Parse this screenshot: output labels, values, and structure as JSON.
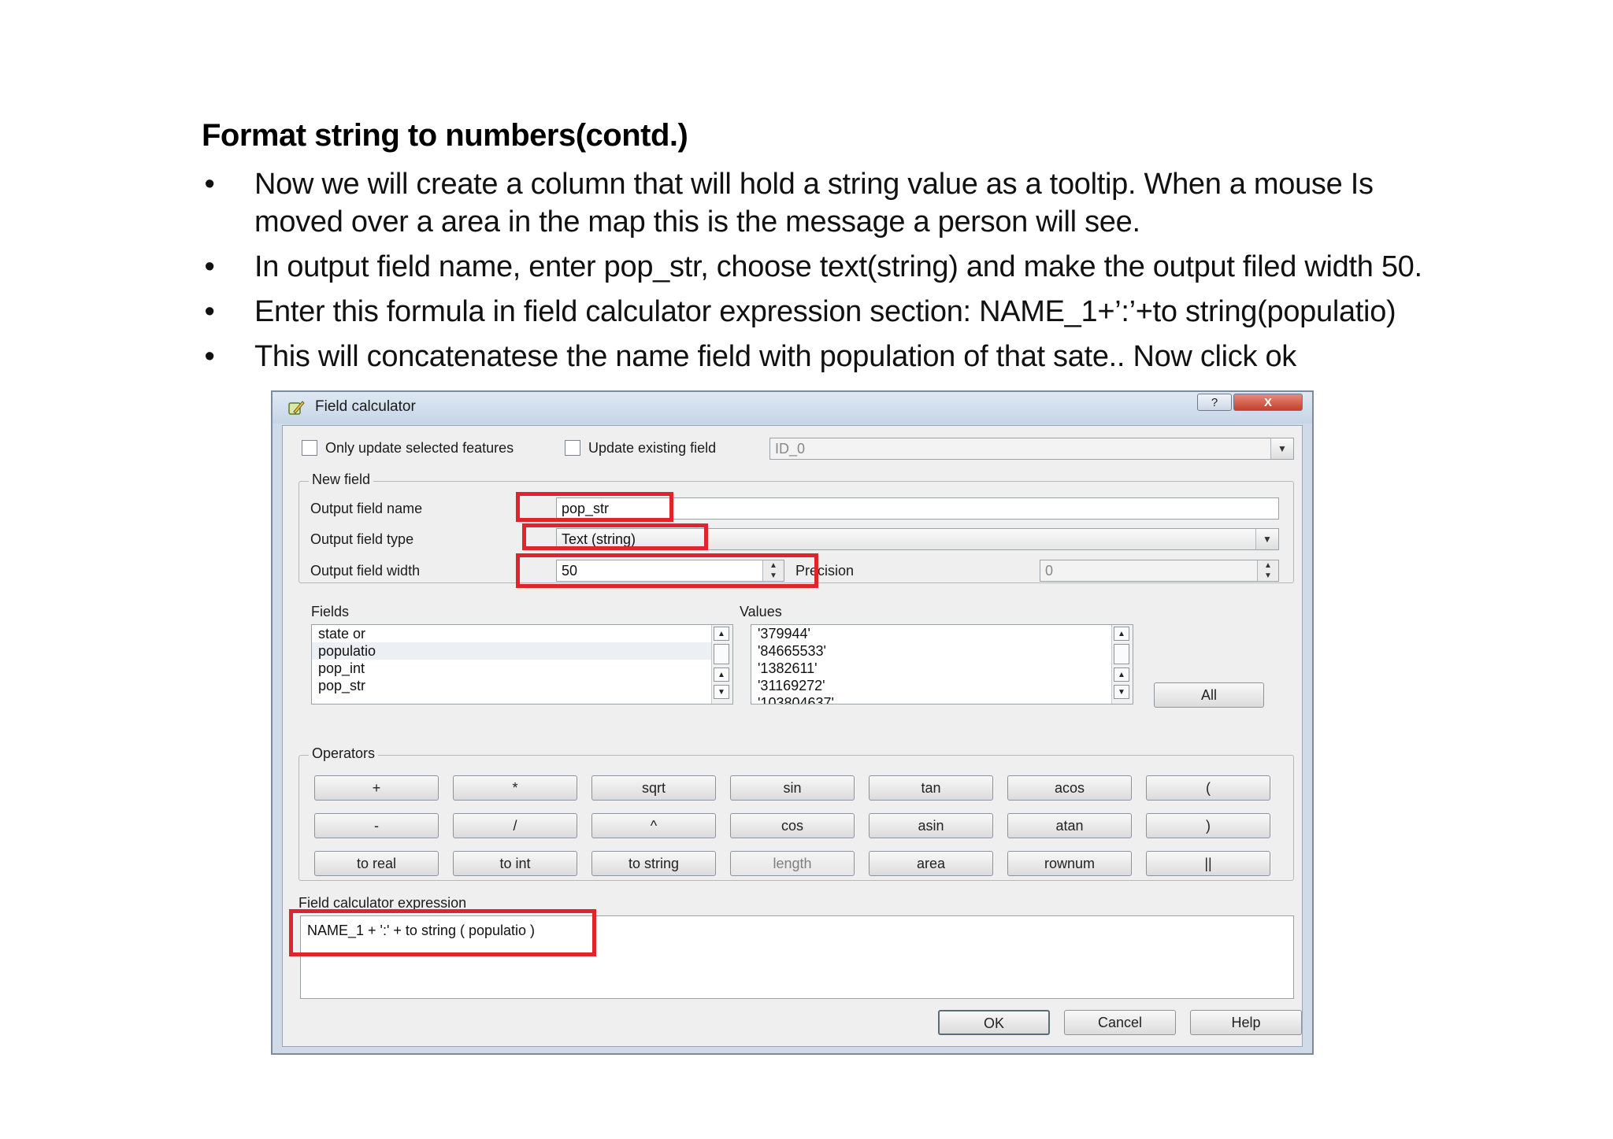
{
  "slide": {
    "title": "Format string to numbers(contd.)",
    "bullets": [
      "Now we will create a column that will hold a string value as a tooltip. When a mouse Is moved over a area in the map this is the message a person will see.",
      "In output field name, enter pop_str, choose text(string) and make the output filed width 50.",
      "Enter this formula in field calculator expression section: NAME_1+’:’+to string(populatio)",
      "This will concatenatese the name field with population of that sate.. Now click ok"
    ]
  },
  "dialog": {
    "title": "Field calculator",
    "help_label": "?",
    "close_label": "X",
    "only_selected_label": "Only update selected features",
    "update_existing_label": "Update existing field",
    "existing_field_value": "ID_0",
    "new_field": {
      "group_title": "New field",
      "name_label": "Output field name",
      "name_value": "pop_str",
      "type_label": "Output field type",
      "type_value": "Text (string)",
      "width_label": "Output field width",
      "width_value": "50",
      "precision_label": "Precision",
      "precision_value": "0"
    },
    "fields": {
      "label": "Fields",
      "items": [
        "state or",
        "populatio",
        "pop_int",
        "pop_str"
      ]
    },
    "values": {
      "label": "Values",
      "items": [
        "'379944'",
        "'84665533'",
        "'1382611'",
        "'31169272'",
        "'103804637'"
      ],
      "all_label": "All"
    },
    "operators": {
      "group_title": "Operators",
      "rows": [
        [
          "+",
          "*",
          "sqrt",
          "sin",
          "tan",
          "acos",
          "("
        ],
        [
          "-",
          "/",
          "^",
          "cos",
          "asin",
          "atan",
          ")"
        ],
        [
          "to real",
          "to int",
          "to string",
          "length",
          "area",
          "rownum",
          "||"
        ]
      ]
    },
    "expression": {
      "label": "Field calculator expression",
      "value": "NAME_1 + ':' + to string ( populatio )"
    },
    "buttons": {
      "ok": "OK",
      "cancel": "Cancel",
      "help": "Help"
    }
  }
}
